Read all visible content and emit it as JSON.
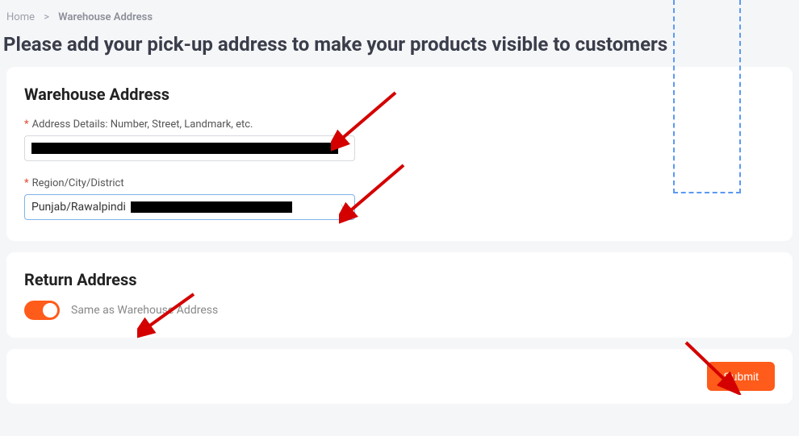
{
  "breadcrumb": {
    "home": "Home",
    "current": "Warehouse Address"
  },
  "page_title": "Please add your pick-up address to make your products visible to customers",
  "warehouse": {
    "title": "Warehouse Address",
    "address_label": "Address Details: Number, Street, Landmark, etc.",
    "region_label": "Region/City/District",
    "region_value": "Punjab/Rawalpindi"
  },
  "return": {
    "title": "Return Address",
    "toggle_label": "Same as Warehouse Address",
    "toggle_on": true
  },
  "submit_label": "Submit"
}
